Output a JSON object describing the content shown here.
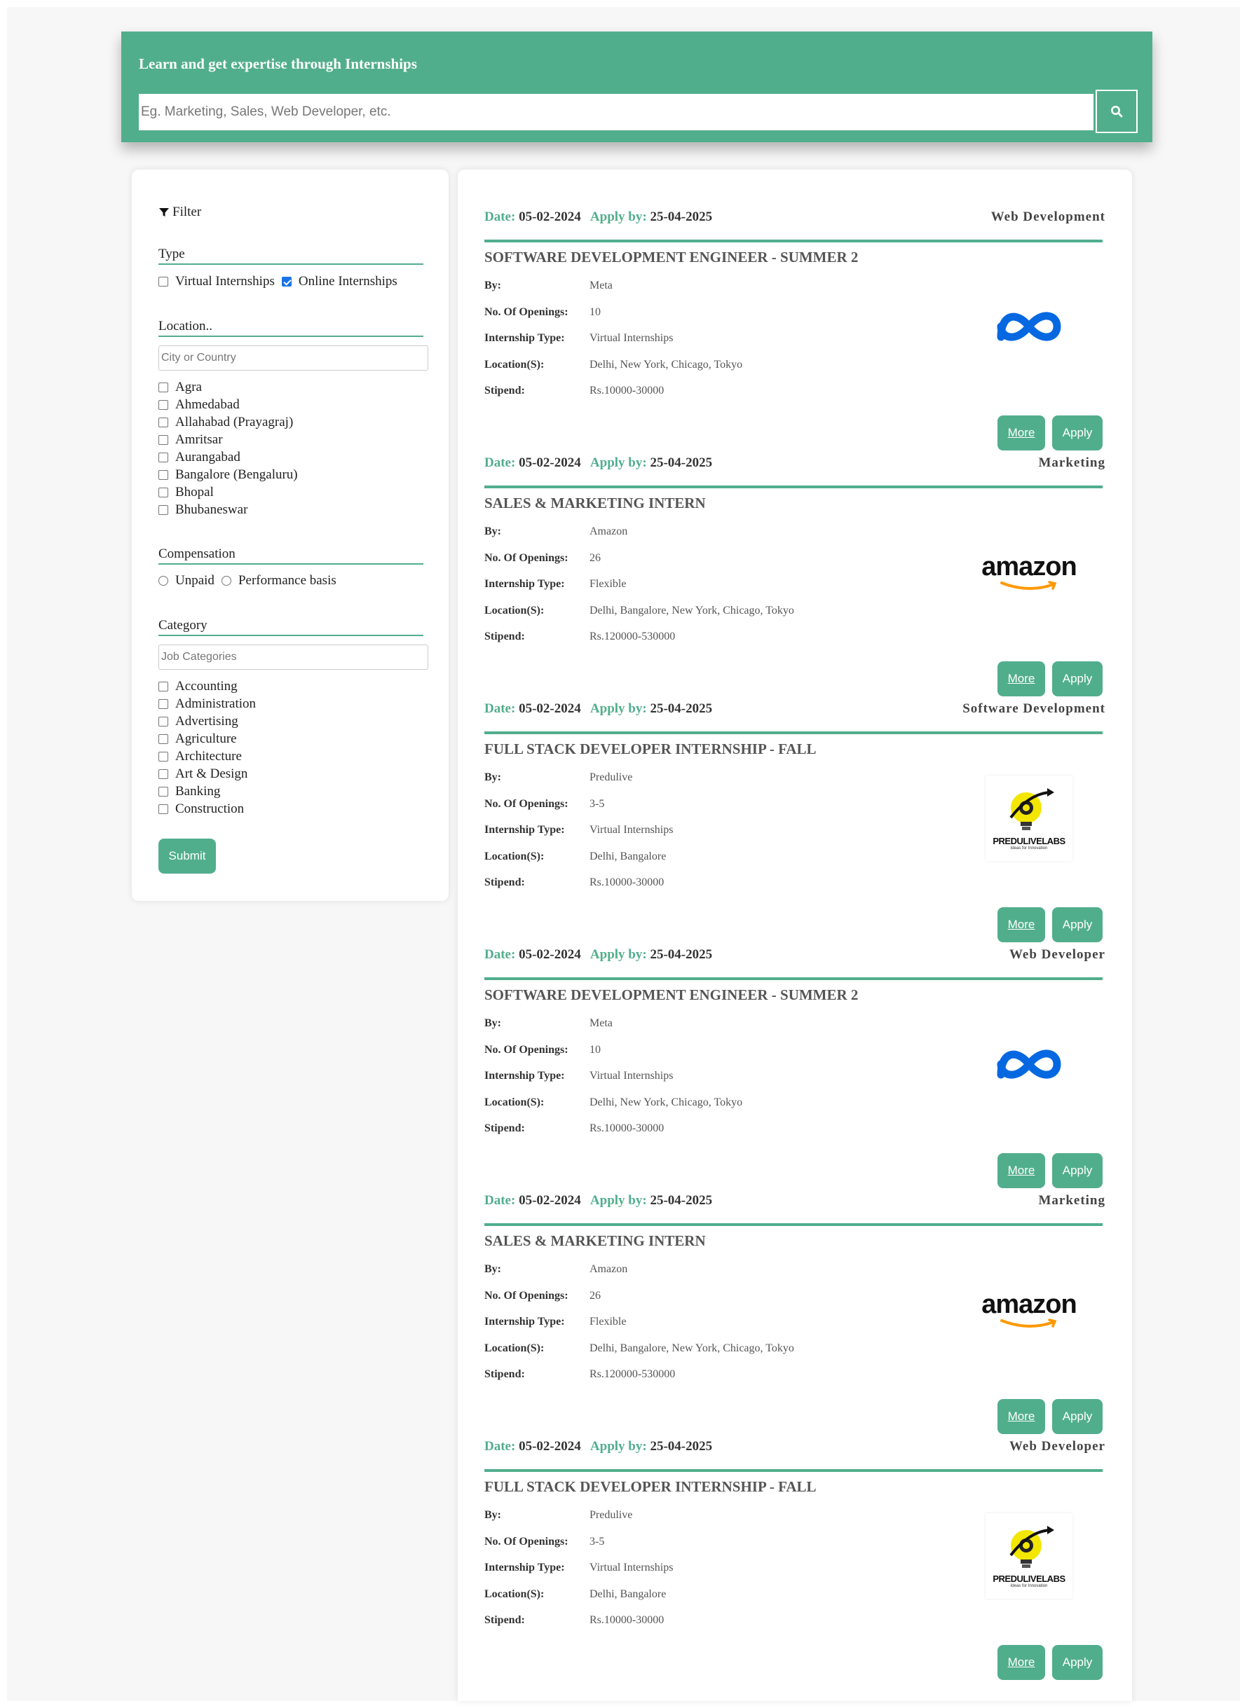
{
  "hero": {
    "title": "Learn and get expertise through Internships",
    "search_placeholder": "Eg. Marketing, Sales, Web Developer, etc.",
    "search_icon": "search-icon"
  },
  "filter": {
    "title": "Filter",
    "type": {
      "heading": "Type",
      "options": [
        {
          "label": "Virtual Internships",
          "checked": false
        },
        {
          "label": "Online Internships",
          "checked": true
        }
      ]
    },
    "location": {
      "heading": "Location..",
      "placeholder": "City or Country",
      "options": [
        "Agra",
        "Ahmedabad",
        "Allahabad (Prayagraj)",
        "Amritsar",
        "Aurangabad",
        "Bangalore (Bengaluru)",
        "Bhopal",
        "Bhubaneswar"
      ]
    },
    "compensation": {
      "heading": "Compensation",
      "options": [
        "Unpaid",
        "Performance basis"
      ]
    },
    "category": {
      "heading": "Category",
      "placeholder": "Job Categories",
      "options": [
        "Accounting",
        "Administration",
        "Advertising",
        "Agriculture",
        "Architecture",
        "Art & Design",
        "Banking",
        "Construction"
      ]
    },
    "submit_label": "Submit"
  },
  "labels": {
    "date": "Date:",
    "apply_by": "Apply by:",
    "by": "By:",
    "openings": "No. Of Openings:",
    "type": "Internship Type:",
    "location": "Location(S):",
    "stipend": "Stipend:",
    "more": "More",
    "apply": "Apply"
  },
  "jobs": [
    {
      "date": "05-02-2024",
      "apply_by": "25-04-2025",
      "category": "Web Development",
      "title": "SOFTWARE DEVELOPMENT ENGINEER - SUMMER 2",
      "company": "Meta",
      "openings": "10",
      "type": "Virtual Internships",
      "locations": "Delhi, New York, Chicago, Tokyo",
      "stipend": "Rs.10000-30000",
      "logo": "meta"
    },
    {
      "date": "05-02-2024",
      "apply_by": "25-04-2025",
      "category": "Marketing",
      "title": "SALES & MARKETING INTERN",
      "company": "Amazon",
      "openings": "26",
      "type": "Flexible",
      "locations": "Delhi, Bangalore, New York, Chicago, Tokyo",
      "stipend": "Rs.120000-530000",
      "logo": "amazon"
    },
    {
      "date": "05-02-2024",
      "apply_by": "25-04-2025",
      "category": "Software Development",
      "title": "FULL STACK DEVELOPER INTERNSHIP - FALL",
      "company": "Predulive",
      "openings": "3-5",
      "type": "Virtual Internships",
      "locations": "Delhi, Bangalore",
      "stipend": "Rs.10000-30000",
      "logo": "predulive"
    },
    {
      "date": "05-02-2024",
      "apply_by": "25-04-2025",
      "category": "Web Developer",
      "title": "SOFTWARE DEVELOPMENT ENGINEER - SUMMER 2",
      "company": "Meta",
      "openings": "10",
      "type": "Virtual Internships",
      "locations": "Delhi, New York, Chicago, Tokyo",
      "stipend": "Rs.10000-30000",
      "logo": "meta"
    },
    {
      "date": "05-02-2024",
      "apply_by": "25-04-2025",
      "category": "Marketing",
      "title": "SALES & MARKETING INTERN",
      "company": "Amazon",
      "openings": "26",
      "type": "Flexible",
      "locations": "Delhi, Bangalore, New York, Chicago, Tokyo",
      "stipend": "Rs.120000-530000",
      "logo": "amazon"
    },
    {
      "date": "05-02-2024",
      "apply_by": "25-04-2025",
      "category": "Web Developer",
      "title": "FULL STACK DEVELOPER INTERNSHIP - FALL",
      "company": "Predulive",
      "openings": "3-5",
      "type": "Virtual Internships",
      "locations": "Delhi, Bangalore",
      "stipend": "Rs.10000-30000",
      "logo": "predulive"
    }
  ],
  "logo_text": {
    "amazon": "amazon",
    "predulive": "PREDULIVELABS",
    "predulive_tag": "Ideas for Innovation"
  },
  "colors": {
    "accent": "#51ae8d",
    "meta_blue": "#0668e1",
    "amazon_orange": "#ff9900"
  }
}
